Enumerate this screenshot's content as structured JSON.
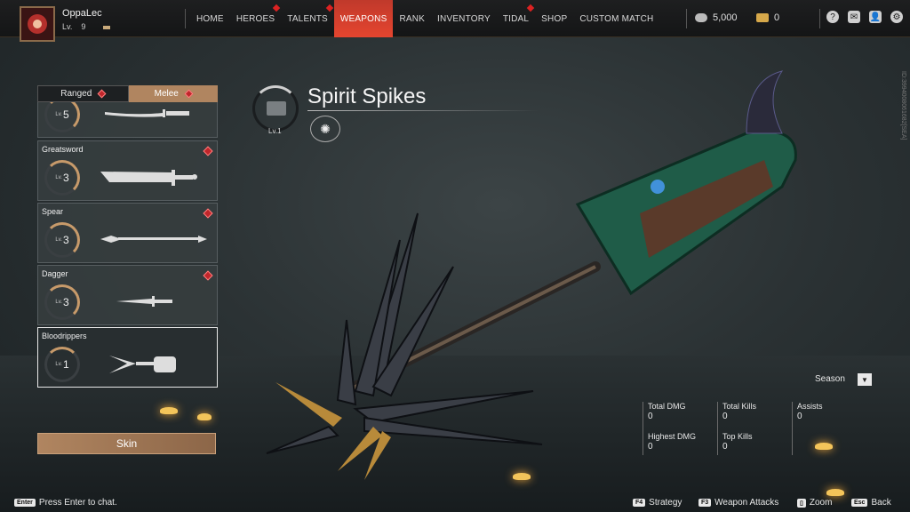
{
  "topbar": {
    "player_name": "OppaLec",
    "level_prefix": "Lv.",
    "level": "9",
    "nav": [
      {
        "label": "HOME",
        "active": false,
        "dot": false
      },
      {
        "label": "HEROES",
        "active": false,
        "dot": true
      },
      {
        "label": "TALENTS",
        "active": false,
        "dot": true
      },
      {
        "label": "WEAPONS",
        "active": true,
        "dot": false
      },
      {
        "label": "RANK",
        "active": false,
        "dot": false
      },
      {
        "label": "INVENTORY",
        "active": false,
        "dot": false
      },
      {
        "label": "TIDAL",
        "active": false,
        "dot": true
      },
      {
        "label": "SHOP",
        "active": false,
        "dot": false
      },
      {
        "label": "CUSTOM MATCH",
        "active": false,
        "dot": false
      }
    ],
    "silver": "5,000",
    "gold": "0",
    "icons": [
      "help-icon",
      "mail-icon",
      "friends-icon",
      "settings-icon"
    ]
  },
  "category_tabs": {
    "ranged": "Ranged",
    "melee": "Melee"
  },
  "weapons": [
    {
      "name": "",
      "lv_prefix": "Lv.",
      "level": "5"
    },
    {
      "name": "Greatsword",
      "lv_prefix": "Lv.",
      "level": "3"
    },
    {
      "name": "Spear",
      "lv_prefix": "Lv.",
      "level": "3"
    },
    {
      "name": "Dagger",
      "lv_prefix": "Lv.",
      "level": "3"
    },
    {
      "name": "Bloodrippers",
      "lv_prefix": "Lv.",
      "level": "1"
    }
  ],
  "skin_button": "Skin",
  "weapon": {
    "title": "Spirit Spikes",
    "emblem_lv": "Lv.1"
  },
  "stats": {
    "season_label": "Season",
    "total_dmg_label": "Total DMG",
    "total_dmg": "0",
    "highest_dmg_label": "Highest DMG",
    "highest_dmg": "0",
    "total_kills_label": "Total Kills",
    "total_kills": "0",
    "top_kills_label": "Top Kills",
    "top_kills": "0",
    "assists_label": "Assists",
    "assists": "0"
  },
  "bottom": {
    "enter_key": "Enter",
    "chat_hint": "Press Enter to chat.",
    "f4_key": "F4",
    "strategy": "Strategy",
    "f3_key": "F3",
    "weapon_attacks": "Weapon Attacks",
    "zoom": "Zoom",
    "esc_key": "Esc",
    "back": "Back"
  },
  "side_id": "ID:3994008061682[SEA]",
  "colors": {
    "accent_red": "#e5452f",
    "melee_tab": "#b08560"
  }
}
